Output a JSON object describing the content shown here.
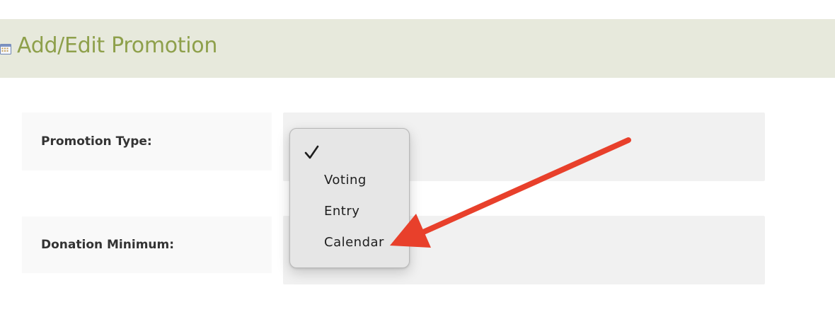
{
  "header": {
    "title": "Add/Edit Promotion",
    "icon": "calendar-icon",
    "title_color": "#8ea04b",
    "background": "#e7e9dc"
  },
  "form": {
    "rows": [
      {
        "label": "Promotion Type:"
      },
      {
        "label": "Donation Minimum:"
      }
    ]
  },
  "dropdown": {
    "selected_index": 0,
    "options": [
      {
        "label": ""
      },
      {
        "label": "Voting"
      },
      {
        "label": "Entry"
      },
      {
        "label": "Calendar"
      }
    ]
  },
  "annotation": {
    "type": "arrow",
    "points_to": "Calendar",
    "color": "#e8402b"
  }
}
